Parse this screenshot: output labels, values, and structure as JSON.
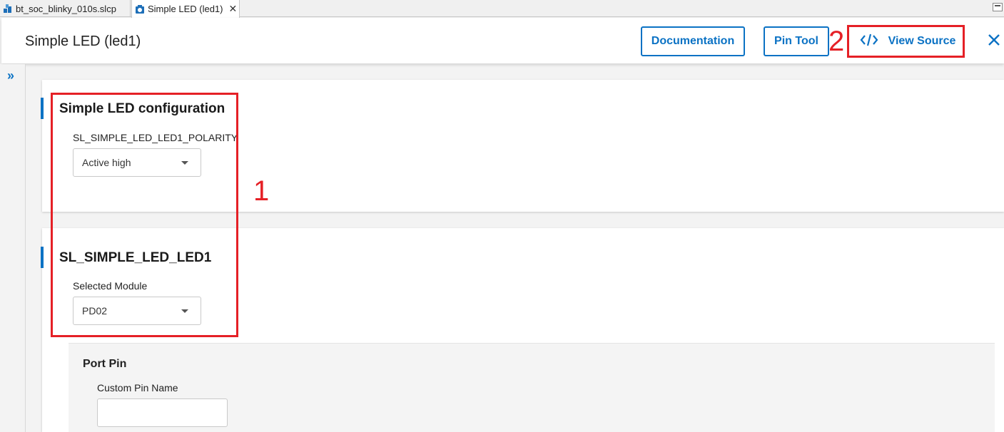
{
  "tabs": [
    {
      "label": "bt_soc_blinky_010s.slcp",
      "icon": "project-icon",
      "active": false
    },
    {
      "label": "Simple LED (led1)",
      "icon": "component-icon",
      "active": true,
      "close": "✕"
    }
  ],
  "header": {
    "title": "Simple LED (led1)",
    "buttons": {
      "documentation": "Documentation",
      "pin_tool": "Pin Tool",
      "view_source": "View Source"
    }
  },
  "annotations": {
    "label_1": "1",
    "label_2": "2"
  },
  "sections": {
    "config": {
      "title": "Simple LED configuration",
      "field_label": "SL_SIMPLE_LED_LED1_POLARITY",
      "field_value": "Active high"
    },
    "led1": {
      "title": "SL_SIMPLE_LED_LED1",
      "field_label": "Selected Module",
      "field_value": "PD02",
      "port_pin": {
        "title": "Port Pin",
        "custom_pin_label": "Custom Pin Name",
        "custom_pin_value": ""
      }
    }
  },
  "colors": {
    "accent": "#0b72c4",
    "annotation": "#e52026"
  }
}
